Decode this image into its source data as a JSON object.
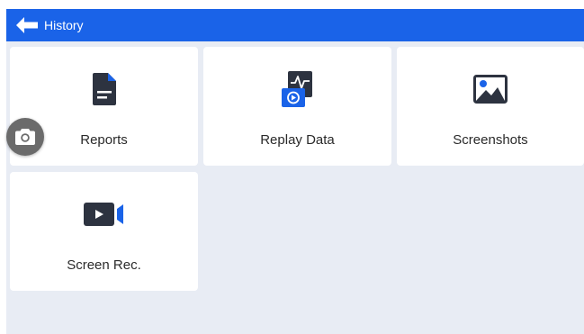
{
  "header": {
    "title": "History",
    "back_icon": "arrow-left-icon"
  },
  "tiles": [
    {
      "label": "Reports",
      "icon": "document-icon"
    },
    {
      "label": "Replay Data",
      "icon": "replay-data-icon"
    },
    {
      "label": "Screenshots",
      "icon": "image-icon"
    },
    {
      "label": "Screen Rec.",
      "icon": "video-camera-icon"
    }
  ],
  "floating_button": {
    "icon": "camera-icon"
  },
  "colors": {
    "header_bg": "#1a63e8",
    "content_bg": "#e8ecf4",
    "tile_bg": "#ffffff",
    "icon_dark": "#2d3340",
    "icon_accent": "#1a63e8",
    "floating_bg": "#6b6b6b"
  }
}
